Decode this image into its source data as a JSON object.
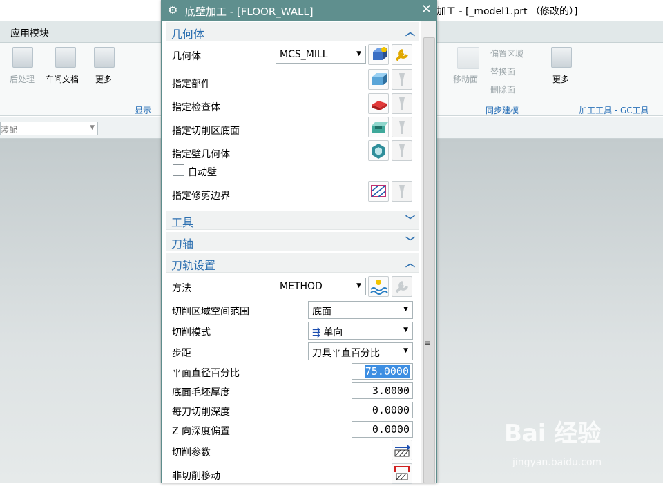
{
  "window": {
    "title": "加工 - [_model1.prt （修改的）]"
  },
  "menubar": {
    "tab": "应用模块"
  },
  "ribbon": {
    "post": "后处理",
    "shop_doc": "车间文档",
    "more": "更多",
    "display_group": "显示",
    "move_face": "移动面",
    "offset_region": "偏置区域",
    "replace_face": "替换面",
    "delete_face": "删除面",
    "more2": "更多",
    "sync_group": "同步建模",
    "mfg_tools_group": "加工工具 - GC工具"
  },
  "assembly_combo": {
    "value": "装配"
  },
  "watermark": {
    "brand": "Bai 经验",
    "url": "jingyan.baidu.com"
  },
  "dialog": {
    "title": "底壁加工 - [FLOOR_WALL]",
    "geometry": {
      "header": "几何体",
      "geometry_label": "几何体",
      "geometry_value": "MCS_MILL",
      "part_label": "指定部件",
      "check_label": "指定检查体",
      "floor_label": "指定切削区底面",
      "wall_label": "指定壁几何体",
      "auto_wall_label": "自动壁",
      "trim_label": "指定修剪边界"
    },
    "tool": {
      "header": "工具"
    },
    "axis": {
      "header": "刀轴"
    },
    "path": {
      "header": "刀轨设置",
      "method_label": "方法",
      "method_value": "METHOD",
      "space_label": "切削区域空间范围",
      "space_value": "底面",
      "pattern_label": "切削模式",
      "pattern_value": "单向",
      "stepover_label": "步距",
      "stepover_value": "刀具平直百分比",
      "percent_label": "平面直径百分比",
      "percent_value": "75.0000",
      "floor_stock_label": "底面毛坯厚度",
      "floor_stock_value": "3.0000",
      "depth_label": "每刀切削深度",
      "depth_value": "0.0000",
      "zoffset_label": "Z 向深度偏置",
      "zoffset_value": "0.0000",
      "cut_params_label": "切削参数",
      "noncut_label": "非切削移动"
    }
  }
}
